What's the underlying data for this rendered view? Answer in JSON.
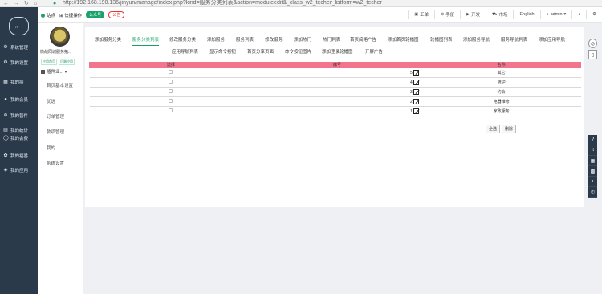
{
  "browser": {
    "url": "http://192.168.190.136/jinyun/manage/index.php?kind=服务分类列表&action=moduleedit&_class_w2_techer_listform=w2_techer"
  },
  "sidebar": {
    "items": [
      {
        "icon": "gear-icon",
        "label": "系统管理"
      },
      {
        "icon": "settings-icon",
        "label": "我的设置"
      },
      {
        "icon": "grid-icon",
        "label": "我的插"
      },
      {
        "icon": "user-icon",
        "label": "我的会员"
      },
      {
        "icon": "plus-circle-icon",
        "label": "我的营件"
      },
      {
        "icon": "chart-icon",
        "label": "我的统计"
      },
      {
        "icon": "chat-icon",
        "label": "我的会费"
      },
      {
        "icon": "gift-icon",
        "label": "我的福番"
      },
      {
        "icon": "layers-icon",
        "label": "我的应用"
      }
    ]
  },
  "topbar": {
    "site_label": "站点",
    "quick_label": "快捷操作",
    "badge_green": "公众号",
    "badge_red": "公告",
    "buttons": [
      {
        "icon": "work-icon",
        "label": "工单"
      },
      {
        "icon": "help-icon",
        "label": "手册"
      },
      {
        "icon": "dev-icon",
        "label": "开发"
      },
      {
        "icon": "market-icon",
        "label": "市场"
      }
    ],
    "language": "English",
    "user": "admin",
    "user_suffix": "·"
  },
  "subside": {
    "shop_name": "微战同城服务拓...",
    "badge1": "应用首页",
    "badge2": "后端应用",
    "plugin_label": "插件业...",
    "menu": [
      "首页基本设置",
      "优选",
      "订单管理",
      "款项管理",
      "我的",
      "系统设置"
    ]
  },
  "tabs": {
    "row1": [
      "添加服务分类",
      "服务分类列表",
      "修改服务分类",
      "添加服务",
      "服务列表",
      "修改服务",
      "添加热门",
      "热门列表",
      "首页简略广告",
      "添加首页轮播图",
      "轮播图列表",
      "添加服务导航",
      "服务导航列表",
      "添加应用导航"
    ],
    "row2": [
      "应用导航列表",
      "显示命令按钮",
      "首页分享页面",
      "命令按钮图片",
      "添加登录轮播图",
      "开屏广告"
    ],
    "active": "服务分类列表"
  },
  "table": {
    "headers": [
      "选择",
      "编号",
      "名称"
    ],
    "rows": [
      {
        "id": "5",
        "name": "其它"
      },
      {
        "id": "4",
        "name": "陪护"
      },
      {
        "id": "3",
        "name": "约会"
      },
      {
        "id": "2",
        "name": "电器维修"
      },
      {
        "id": "1",
        "name": "家政服务"
      }
    ]
  },
  "actions": {
    "select_all": "全选",
    "delete": "删除"
  },
  "right_tools": [
    "compass-icon",
    "copy-icon",
    "question-icon",
    "bell-icon",
    "qrcode-icon",
    "qrcode2-icon",
    "wechat-icon",
    "phone-icon"
  ],
  "colors": {
    "accent": "#1aa26a",
    "table_header": "#f2758d",
    "sidebar_bg": "#2b3a4a"
  }
}
